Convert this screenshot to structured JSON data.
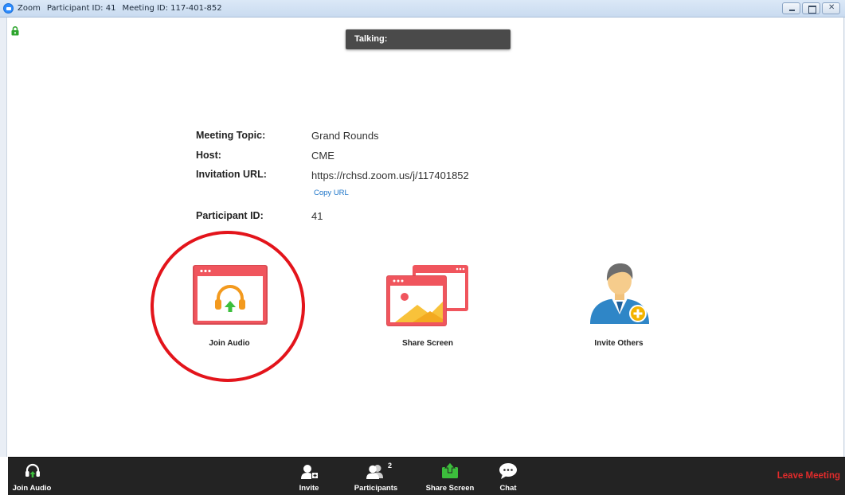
{
  "window": {
    "app_name": "Zoom",
    "participant_id_title": "Participant ID: 41",
    "meeting_id_title": "Meeting ID: 117-401-852"
  },
  "talking": {
    "label": "Talking:"
  },
  "info": {
    "topic_label": "Meeting Topic:",
    "topic_value": "Grand Rounds",
    "host_label": "Host:",
    "host_value": "CME",
    "url_label": "Invitation URL:",
    "url_value": "https://rchsd.zoom.us/j/117401852",
    "copy_url": "Copy URL",
    "participant_label": "Participant ID:",
    "participant_value": "41"
  },
  "actions": {
    "join_audio": "Join Audio",
    "share_screen": "Share Screen",
    "invite_others": "Invite Others"
  },
  "toolbar": {
    "join_audio": "Join Audio",
    "invite": "Invite",
    "participants": "Participants",
    "participants_count": "2",
    "share_screen": "Share Screen",
    "chat": "Chat",
    "leave_meeting": "Leave Meeting"
  },
  "colors": {
    "tile_red": "#f0555d",
    "audio_orange": "#f39a1e",
    "arrow_green": "#3cbf3c",
    "leave_red": "#e02b2b",
    "annotation_red": "#e3141b"
  }
}
